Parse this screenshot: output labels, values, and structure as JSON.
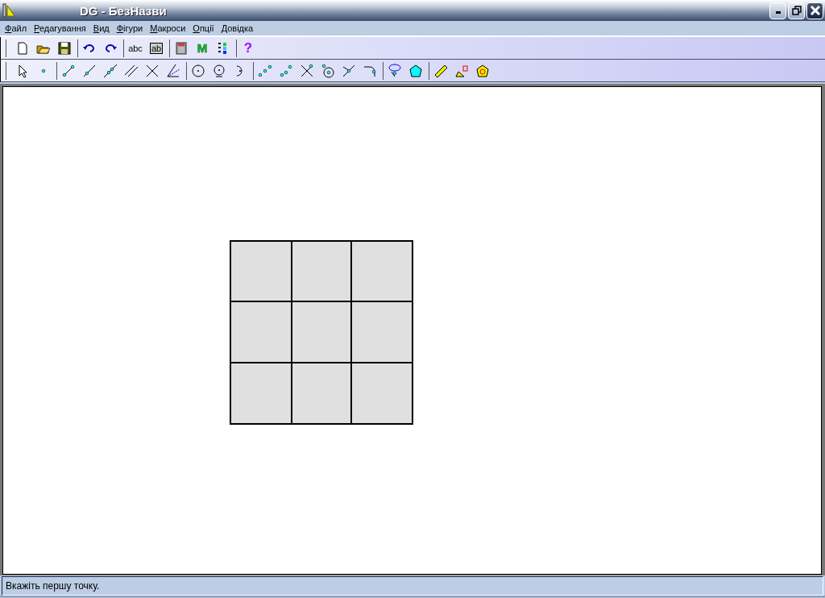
{
  "window": {
    "title": "DG - БезНазви"
  },
  "menu": [
    {
      "label": "Файл"
    },
    {
      "label": "Редагування"
    },
    {
      "label": "Вид"
    },
    {
      "label": "Фігури"
    },
    {
      "label": "Макроси"
    },
    {
      "label": "Опції"
    },
    {
      "label": "Довідка"
    }
  ],
  "toolbar": {
    "text_tool": "abc",
    "label_tool": "ab",
    "macro_tool": "M",
    "help": "?"
  },
  "status_bar": {
    "text": "Вкажіть першу точку."
  }
}
